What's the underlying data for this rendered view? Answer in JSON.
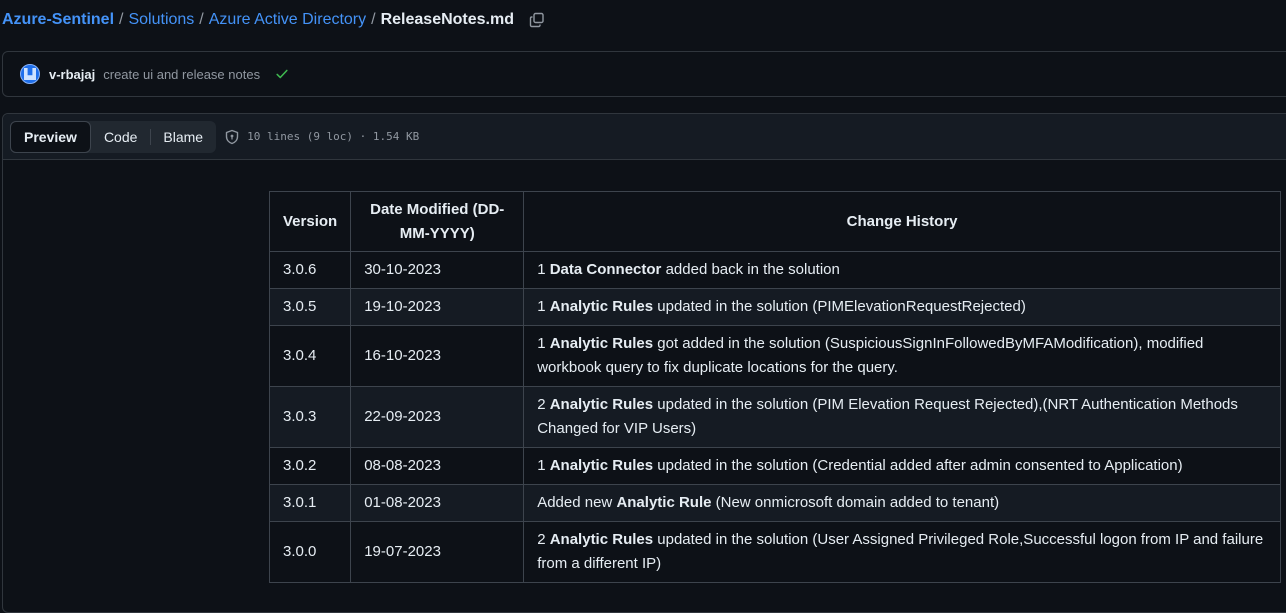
{
  "breadcrumb": {
    "repo": "Azure-Sentinel",
    "path": [
      "Solutions",
      "Azure Active Directory"
    ],
    "separator": "/",
    "file": "ReleaseNotes.md"
  },
  "commit": {
    "author": "v-rbajaj",
    "message": "create ui and release notes",
    "status_icon": "check-icon"
  },
  "file_header": {
    "tabs": [
      "Preview",
      "Code",
      "Blame"
    ],
    "active_tab": "Preview",
    "info": "10 lines (9 loc) · 1.54 KB"
  },
  "table": {
    "headers": [
      "Version",
      "Date Modified (DD-MM-YYYY)",
      "Change History"
    ],
    "rows": [
      {
        "version": "3.0.6",
        "date": "30-10-2023",
        "pre": "1 ",
        "bold": "Data Connector",
        "post": " added back in the solution"
      },
      {
        "version": "3.0.5",
        "date": "19-10-2023",
        "pre": "1 ",
        "bold": "Analytic Rules",
        "post": " updated in the solution (PIMElevationRequestRejected)"
      },
      {
        "version": "3.0.4",
        "date": "16-10-2023",
        "pre": "1 ",
        "bold": "Analytic Rules",
        "post": " got added in the solution (SuspiciousSignInFollowedByMFAModification), modified workbook query to fix duplicate locations for the query."
      },
      {
        "version": "3.0.3",
        "date": "22-09-2023",
        "pre": "2 ",
        "bold": "Analytic Rules",
        "post": " updated in the solution (PIM Elevation Request Rejected),(NRT Authentication Methods Changed for VIP Users)"
      },
      {
        "version": "3.0.2",
        "date": "08-08-2023",
        "pre": "1 ",
        "bold": "Analytic Rules",
        "post": " updated in the solution (Credential added after admin consented to Application)"
      },
      {
        "version": "3.0.1",
        "date": "01-08-2023",
        "pre": "Added new ",
        "bold": "Analytic Rule",
        "post": " (New onmicrosoft domain added to tenant)"
      },
      {
        "version": "3.0.0",
        "date": "19-07-2023",
        "pre": "2 ",
        "bold": "Analytic Rules",
        "post": " updated in the solution (User Assigned Privileged Role,Successful logon from IP and failure from a different IP)"
      }
    ]
  }
}
